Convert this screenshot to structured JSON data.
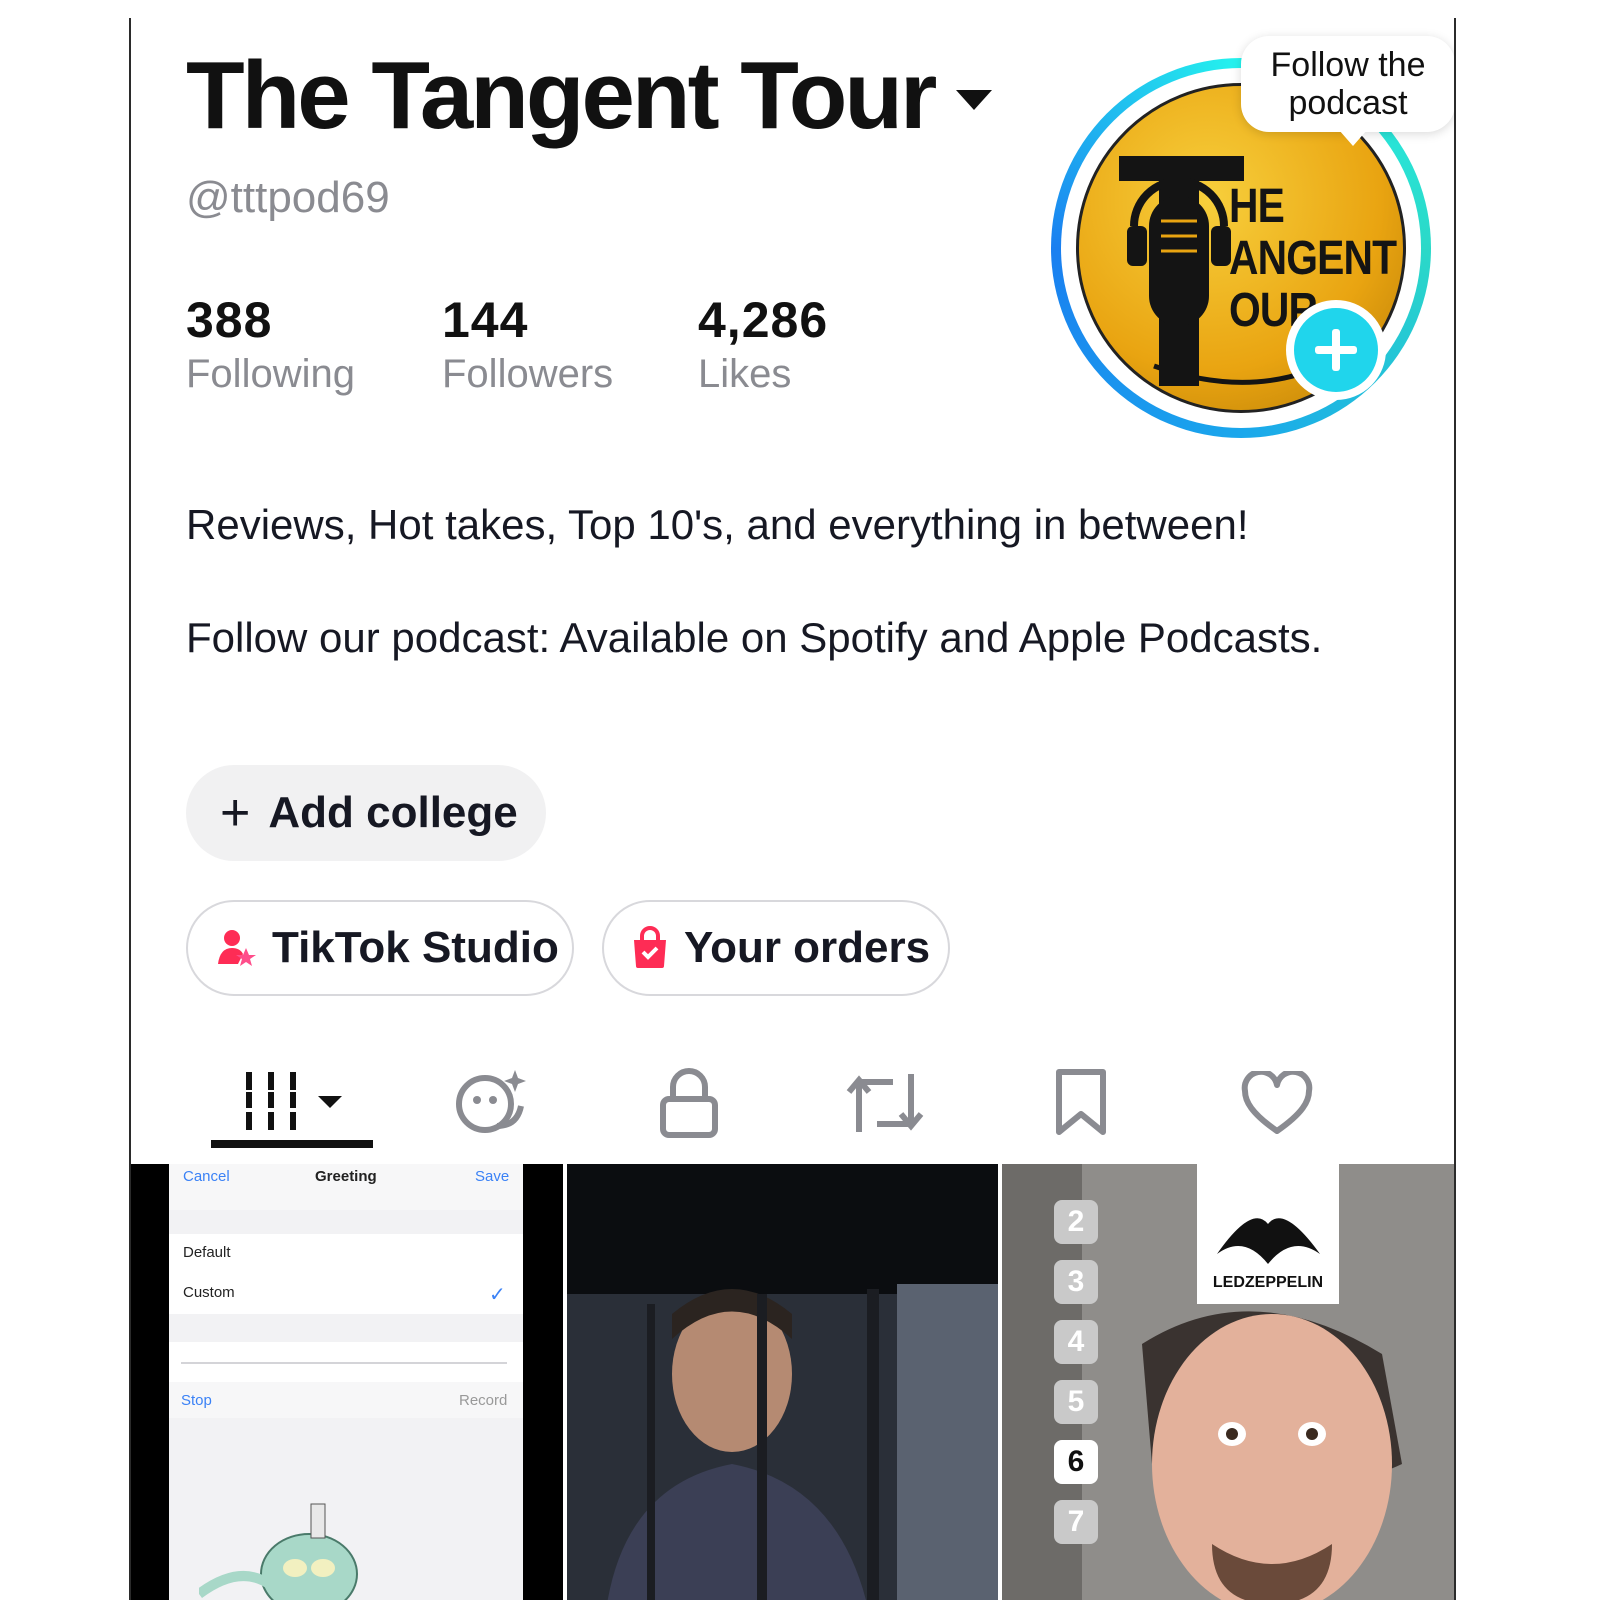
{
  "profile": {
    "display_name": "The Tangent Tour",
    "handle": "@tttpod69",
    "stats": [
      {
        "value": "388",
        "label": "Following"
      },
      {
        "value": "144",
        "label": "Followers"
      },
      {
        "value": "4,286",
        "label": "Likes"
      }
    ],
    "tooltip": "Follow the podcast",
    "avatar_logo_lines": [
      "HE",
      "ANGENT",
      "OUR"
    ],
    "bio_line1": "Reviews, Hot takes, Top 10's, and everything in between!",
    "bio_line2": "Follow our podcast: Available on Spotify and Apple Podcasts."
  },
  "actions": {
    "add_college": "Add college",
    "studio": "TikTok Studio",
    "orders": "Your orders"
  },
  "tabs": [
    "videos-grid",
    "ai-self",
    "private",
    "reposts",
    "favorites",
    "liked"
  ],
  "thumbs": {
    "t1": {
      "cancel": "Cancel",
      "title": "Greeting",
      "save": "Save",
      "opt1": "Default",
      "opt2": "Custom",
      "stop": "Stop",
      "record": "Record"
    },
    "t3": {
      "numbers": [
        "2",
        "3",
        "4",
        "5",
        "6",
        "7"
      ],
      "logo_text": "LEDZEPPELIN"
    }
  },
  "colors": {
    "accent_cyan": "#20d5ec",
    "accent_pink": "#fe2c55",
    "text_primary": "#161823",
    "text_secondary": "#8a8b91"
  }
}
